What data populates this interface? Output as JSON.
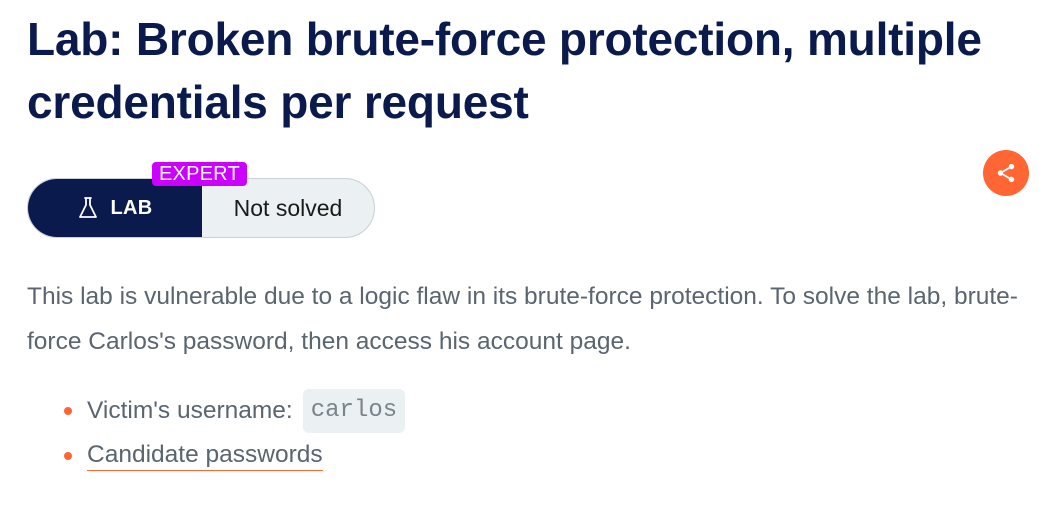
{
  "lab": {
    "title": "Lab: Broken brute-force protection, multiple credentials per request",
    "level": "EXPERT",
    "type_label": "LAB",
    "status": "Not solved",
    "description": "This lab is vulnerable due to a logic flaw in its brute-force protection. To solve the lab, brute-force Carlos's password, then access his account page.",
    "victim_label": "Victim's username:",
    "victim_username": "carlos",
    "candidate_link_label": "Candidate passwords"
  },
  "icons": {
    "lab": "flask-icon",
    "share": "share-icon"
  },
  "colors": {
    "title": "#0a1a4c",
    "lab_segment": "#0a1a4c",
    "level_badge": "#cc00ff",
    "accent": "#ff6633",
    "status_background": "#ebf0f2",
    "body_text": "#5a6570"
  }
}
